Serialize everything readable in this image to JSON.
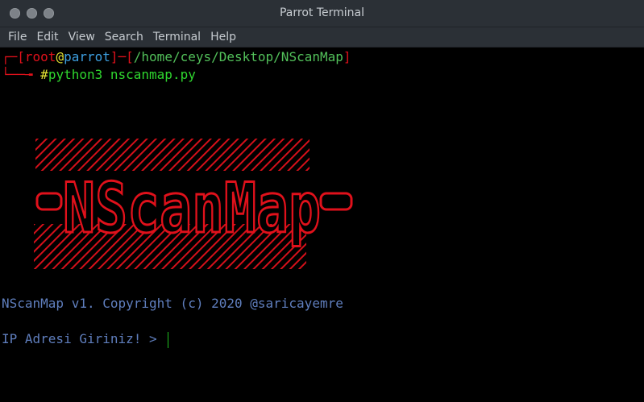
{
  "window": {
    "title": "Parrot Terminal",
    "controls": [
      "close",
      "minimize",
      "maximize"
    ]
  },
  "menu": [
    "File",
    "Edit",
    "View",
    "Search",
    "Terminal",
    "Help"
  ],
  "prompt": {
    "open_bracket": "┌─[",
    "user": "root",
    "at": "@",
    "host": "parrot",
    "between": "]─[",
    "path": "/home/ceys/Desktop/NScanMap",
    "close_bracket": "]",
    "corner": "└──╼",
    "hash": "#",
    "command": "python3 nscanmap.py"
  },
  "logo": {
    "text": "NScanMap",
    "color": "#e0111b"
  },
  "banner": "NScanMap v1. Copyright (c) 2020 @saricayemre",
  "input_prompt": "IP Adresi Giriniz! > ",
  "colors": {
    "bracket": "#e0111b",
    "user": "#e0111b",
    "host": "#3d9fe0",
    "path": "#52c05a",
    "command": "#2fd72f",
    "banner": "#5f7ebd"
  }
}
